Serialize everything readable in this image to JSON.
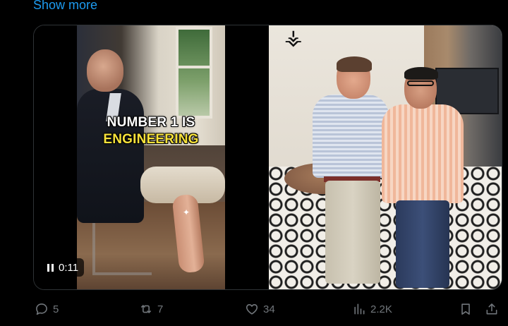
{
  "post": {
    "show_more_label": "Show more"
  },
  "media": {
    "video": {
      "caption_line1": "NUMBER 1 IS",
      "caption_line2": "ENGINEERING",
      "timer": "0:11",
      "state": "playing"
    }
  },
  "actions": {
    "replies": "5",
    "reposts": "7",
    "likes": "34",
    "views": "2.2K"
  },
  "colors": {
    "link": "#1d9bf0",
    "icon_gray": "#71767b",
    "caption_yellow": "#f7e23b"
  }
}
